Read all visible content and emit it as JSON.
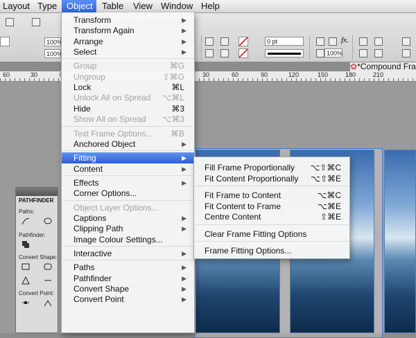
{
  "menubar": {
    "items": [
      "Layout",
      "Type",
      "Object",
      "Table",
      "View",
      "Window",
      "Help"
    ],
    "active": "Object"
  },
  "controls": {
    "percent_top": "100%",
    "percent_bottom": "100%",
    "stroke_weight": "0 pt",
    "opacity": "100%"
  },
  "document_tab": "*Compound Fra",
  "ruler": {
    "ticks": [
      "60",
      "30",
      "0",
      "30",
      "60",
      "90",
      "120",
      "150",
      "180",
      "210"
    ]
  },
  "object_menu": {
    "groups": [
      [
        {
          "label": "Transform",
          "submenu": true
        },
        {
          "label": "Transform Again",
          "submenu": true
        },
        {
          "label": "Arrange",
          "submenu": true
        },
        {
          "label": "Select",
          "submenu": true
        }
      ],
      [
        {
          "label": "Group",
          "shortcut": "⌘G",
          "disabled": true
        },
        {
          "label": "Ungroup",
          "shortcut": "⇧⌘G",
          "disabled": true
        },
        {
          "label": "Lock",
          "shortcut": "⌘L"
        },
        {
          "label": "Unlock All on Spread",
          "shortcut": "⌥⌘L",
          "disabled": true
        },
        {
          "label": "Hide",
          "shortcut": "⌘3"
        },
        {
          "label": "Show All on Spread",
          "shortcut": "⌥⌘3",
          "disabled": true
        }
      ],
      [
        {
          "label": "Text Frame Options...",
          "shortcut": "⌘B",
          "disabled": true
        },
        {
          "label": "Anchored Object",
          "submenu": true
        }
      ],
      [
        {
          "label": "Fitting",
          "submenu": true,
          "highlighted": true
        },
        {
          "label": "Content",
          "submenu": true
        }
      ],
      [
        {
          "label": "Effects",
          "submenu": true
        },
        {
          "label": "Corner Options..."
        }
      ],
      [
        {
          "label": "Object Layer Options...",
          "disabled": true
        },
        {
          "label": "Captions",
          "submenu": true
        },
        {
          "label": "Clipping Path",
          "submenu": true
        },
        {
          "label": "Image Colour Settings..."
        }
      ],
      [
        {
          "label": "Interactive",
          "submenu": true
        }
      ],
      [
        {
          "label": "Paths",
          "submenu": true
        },
        {
          "label": "Pathfinder",
          "submenu": true
        },
        {
          "label": "Convert Shape",
          "submenu": true
        },
        {
          "label": "Convert Point",
          "submenu": true
        }
      ]
    ]
  },
  "fitting_submenu": {
    "groups": [
      [
        {
          "label": "Fill Frame Proportionally",
          "shortcut": "⌥⇧⌘C"
        },
        {
          "label": "Fit Content Proportionally",
          "shortcut": "⌥⇧⌘E"
        }
      ],
      [
        {
          "label": "Fit Frame to Content",
          "shortcut": "⌥⌘C"
        },
        {
          "label": "Fit Content to Frame",
          "shortcut": "⌥⌘E"
        },
        {
          "label": "Centre Content",
          "shortcut": "⇧⌘E"
        }
      ],
      [
        {
          "label": "Clear Frame Fitting Options"
        }
      ],
      [
        {
          "label": "Frame Fitting Options..."
        }
      ]
    ]
  },
  "pathfinder_panel": {
    "title": "PATHFINDER",
    "sections": [
      "Paths:",
      "Pathfinder:",
      "Convert Shape:",
      "Convert Point:"
    ]
  }
}
